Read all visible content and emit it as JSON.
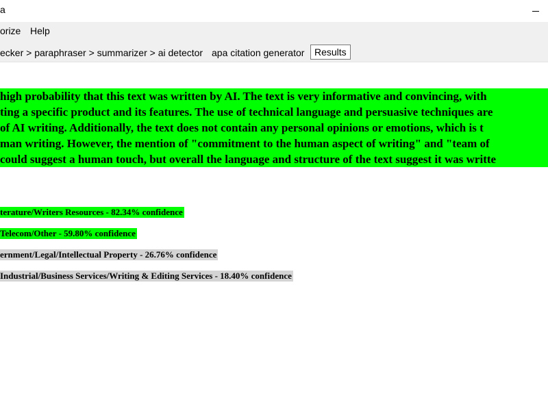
{
  "window": {
    "title": "a"
  },
  "menu": {
    "items": [
      "orize",
      "Help"
    ]
  },
  "nav": {
    "items": [
      "ecker > paraphraser > summarizer > ai detector",
      "apa citation generator"
    ],
    "active_tab": "Results"
  },
  "analysis": {
    "lines": [
      "high probability that this text was written by AI. The text is very informative and convincing, with",
      "ting a specific product and its features. The use of technical language and persuasive techniques are",
      "of AI writing. Additionally, the text does not contain any personal opinions or emotions, which is t",
      "man writing. However, the mention of \"commitment to the human aspect of writing\" and \"team of",
      "could suggest a human touch, but overall the language and structure of the text suggest it was writte"
    ],
    "highlight_color": "#00ff00"
  },
  "categories": [
    {
      "text": "terature/Writers Resources - 82.34% confidence",
      "level": "high"
    },
    {
      "text": "Telecom/Other - 59.80% confidence",
      "level": "high"
    },
    {
      "text": "ernment/Legal/Intellectual Property - 26.76% confidence",
      "level": "low"
    },
    {
      "text": "Industrial/Business Services/Writing & Editing Services - 18.40% confidence",
      "level": "low"
    }
  ],
  "colors": {
    "high": "#00ff00",
    "low": "#d4d4d4"
  }
}
